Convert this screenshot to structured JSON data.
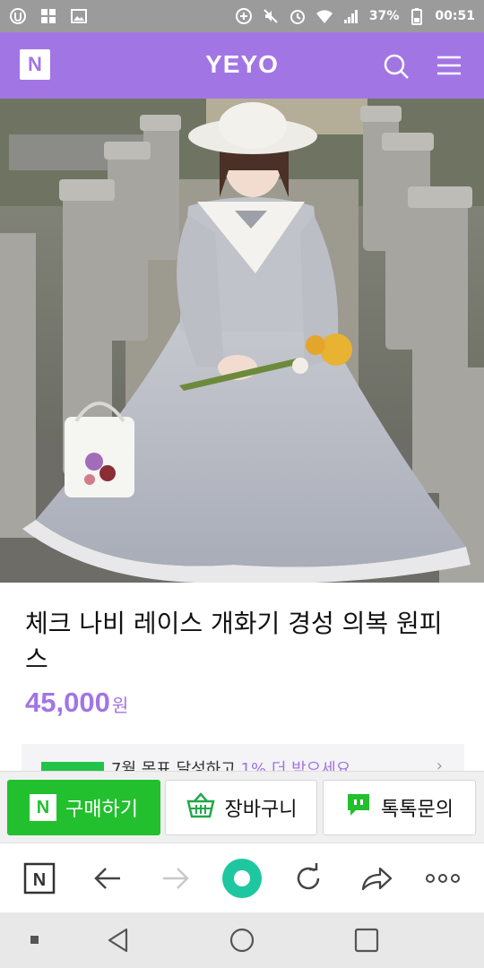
{
  "status_bar": {
    "battery": "37%",
    "time": "00:51"
  },
  "header": {
    "logo_letter": "N",
    "title": "YEYO",
    "accent": "#a275e4"
  },
  "carousel": {
    "total": 10,
    "active_index": 0
  },
  "product": {
    "title": "체크 나비 레이스 개화기 경성 의복 원피스",
    "price": "45,000",
    "currency": "원"
  },
  "promo": {
    "text_pre": "7월 목표 달성하고 ",
    "text_highlight": "1% 더 받으세요"
  },
  "actions": {
    "buy_label": "구매하기",
    "buy_logo": "N",
    "cart_label": "장바구니",
    "talk_label": "톡톡문의",
    "buy_color": "#22c02e"
  },
  "browser": {
    "home_letter": "N"
  },
  "icons": [
    "search-icon",
    "menu-icon",
    "basket-icon",
    "chat-icon",
    "back-arrow-icon",
    "forward-arrow-icon",
    "refresh-icon",
    "share-icon",
    "more-icon"
  ]
}
